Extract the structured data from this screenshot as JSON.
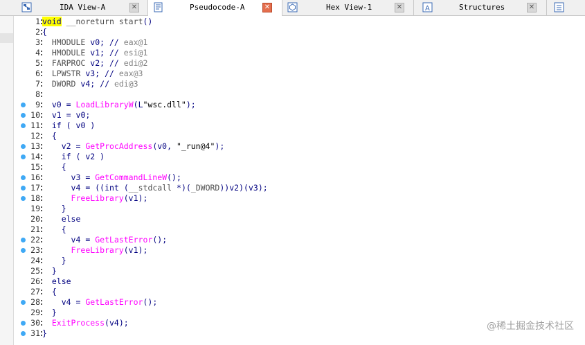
{
  "tabs": [
    {
      "label": "IDA View-A",
      "icon": "ida-view-icon",
      "active": false
    },
    {
      "label": "Pseudocode-A",
      "icon": "pseudocode-icon",
      "active": true
    },
    {
      "label": "Hex View-1",
      "icon": "hex-view-icon",
      "active": false
    },
    {
      "label": "Structures",
      "icon": "structures-icon",
      "active": false
    }
  ],
  "code_lines": [
    {
      "n": "1",
      "bp": false,
      "text": "void __noreturn start()"
    },
    {
      "n": "2",
      "bp": false,
      "text": "{"
    },
    {
      "n": "3",
      "bp": false,
      "text": "  HMODULE v0; // eax@1"
    },
    {
      "n": "4",
      "bp": false,
      "text": "  HMODULE v1; // esi@1"
    },
    {
      "n": "5",
      "bp": false,
      "text": "  FARPROC v2; // edi@2"
    },
    {
      "n": "6",
      "bp": false,
      "text": "  LPWSTR v3; // eax@3"
    },
    {
      "n": "7",
      "bp": false,
      "text": "  DWORD v4; // edi@3"
    },
    {
      "n": "8",
      "bp": false,
      "text": ""
    },
    {
      "n": "9",
      "bp": true,
      "text": "  v0 = LoadLibraryW(L\"wsc.dll\");"
    },
    {
      "n": "10",
      "bp": true,
      "text": "  v1 = v0;"
    },
    {
      "n": "11",
      "bp": true,
      "text": "  if ( v0 )"
    },
    {
      "n": "12",
      "bp": false,
      "text": "  {"
    },
    {
      "n": "13",
      "bp": true,
      "text": "    v2 = GetProcAddress(v0, \"_run@4\");"
    },
    {
      "n": "14",
      "bp": true,
      "text": "    if ( v2 )"
    },
    {
      "n": "15",
      "bp": false,
      "text": "    {"
    },
    {
      "n": "16",
      "bp": true,
      "text": "      v3 = GetCommandLineW();"
    },
    {
      "n": "17",
      "bp": true,
      "text": "      v4 = ((int (__stdcall *)(_DWORD))v2)(v3);"
    },
    {
      "n": "18",
      "bp": true,
      "text": "      FreeLibrary(v1);"
    },
    {
      "n": "19",
      "bp": false,
      "text": "    }"
    },
    {
      "n": "20",
      "bp": false,
      "text": "    else"
    },
    {
      "n": "21",
      "bp": false,
      "text": "    {"
    },
    {
      "n": "22",
      "bp": true,
      "text": "      v4 = GetLastError();"
    },
    {
      "n": "23",
      "bp": true,
      "text": "      FreeLibrary(v1);"
    },
    {
      "n": "24",
      "bp": false,
      "text": "    }"
    },
    {
      "n": "25",
      "bp": false,
      "text": "  }"
    },
    {
      "n": "26",
      "bp": false,
      "text": "  else"
    },
    {
      "n": "27",
      "bp": false,
      "text": "  {"
    },
    {
      "n": "28",
      "bp": true,
      "text": "    v4 = GetLastError();"
    },
    {
      "n": "29",
      "bp": false,
      "text": "  }"
    },
    {
      "n": "30",
      "bp": true,
      "text": "  ExitProcess(v4);"
    },
    {
      "n": "31",
      "bp": true,
      "text": "}"
    }
  ],
  "watermark": "@稀土掘金技术社区",
  "colors": {
    "keyword": "#000080",
    "function": "#ff00ff",
    "comment": "#808080",
    "breakpoint": "#3fa9f5",
    "active_close": "#e46e4d"
  }
}
